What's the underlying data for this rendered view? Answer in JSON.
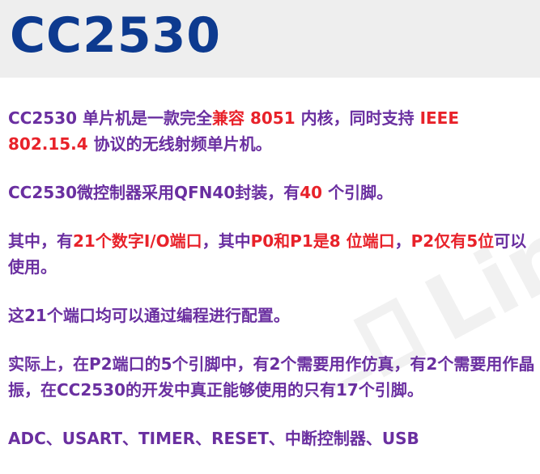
{
  "header": {
    "title": "CC2530"
  },
  "paragraphs": {
    "p1": {
      "t1": "CC2530 单片机是一款完全",
      "t2": "兼容 8051",
      "t3": " 内核，同时支持 ",
      "t4": "IEEE 802.15.4",
      "t5": " 协议的无线射频单片机。"
    },
    "p2": {
      "t1": "CC2530微控制器采用QFN40封装，有",
      "t2": "40",
      "t3": " 个引脚。"
    },
    "p3": {
      "t1": "其中，有",
      "t2": "21个数字I/O端口",
      "t3": "，其中",
      "t4": "P0和P1是8 位端口",
      "t5": "，",
      "t6": "P2仅有5位",
      "t7": "可以使用。"
    },
    "p4": {
      "t1": "这21个端口均可以通过编程进行配置。"
    },
    "p5": {
      "t1": "实际上，在P2端口的5个引脚中，有2个需要用作仿真，有2个需要用作晶振，在CC2530的开发中真正能够使用的只有17个引脚。"
    },
    "p6": {
      "t1": "ADC、USART、TIMER、RESET、中断控制器、USB"
    }
  },
  "watermark": {
    "text": "Lin"
  }
}
